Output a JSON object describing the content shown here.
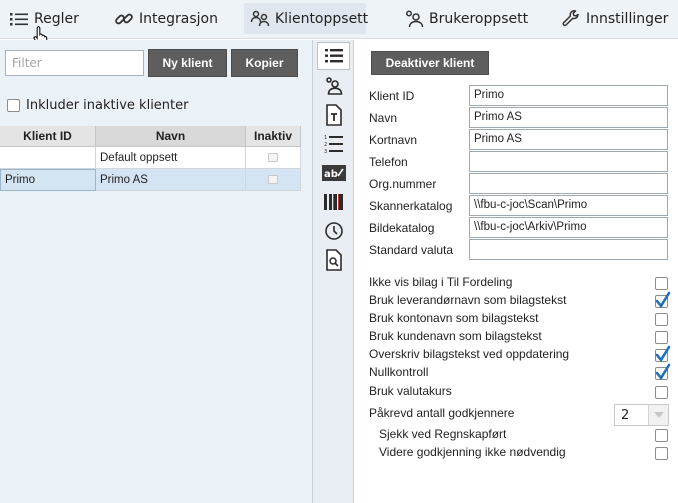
{
  "nav": {
    "items": [
      {
        "label": "Regler",
        "icon": "list-icon"
      },
      {
        "label": "Integrasjon",
        "icon": "link-icon"
      },
      {
        "label": "Klientoppsett",
        "icon": "clients-icon",
        "active": true
      },
      {
        "label": "Brukeroppsett",
        "icon": "users-icon"
      },
      {
        "label": "Innstillinger",
        "icon": "wrench-icon"
      }
    ]
  },
  "left": {
    "filter_placeholder": "Filter",
    "new_client_label": "Ny klient",
    "copy_label": "Kopier",
    "include_inactive_label": "Inkluder inaktive klienter",
    "grid": {
      "columns": [
        "Klient ID",
        "Navn",
        "Inaktiv"
      ],
      "rows": [
        {
          "id": "",
          "name": "Default oppsett",
          "inactive": false
        },
        {
          "id": "Primo",
          "name": "Primo AS",
          "inactive": false,
          "selected": true
        }
      ]
    }
  },
  "strip": {
    "icons": [
      "list-detail-icon",
      "client-user-icon",
      "document-text-icon",
      "numbered-list-icon",
      "spellcheck-icon",
      "barcode-icon",
      "clock-icon",
      "document-search-icon"
    ]
  },
  "right": {
    "deactivate_label": "Deaktiver klient",
    "fields": [
      {
        "label": "Klient ID",
        "value": "Primo"
      },
      {
        "label": "Navn",
        "value": "Primo AS"
      },
      {
        "label": "Kortnavn",
        "value": "Primo AS"
      },
      {
        "label": "Telefon",
        "value": ""
      },
      {
        "label": "Org.nummer",
        "value": ""
      },
      {
        "label": "Skannerkatalog",
        "value": "\\\\fbu-c-joc\\Scan\\Primo"
      },
      {
        "label": "Bildekatalog",
        "value": "\\\\fbu-c-joc\\Arkiv\\Primo"
      },
      {
        "label": "Standard valuta",
        "value": ""
      }
    ],
    "options": [
      {
        "label": "Ikke vis bilag i Til Fordeling",
        "checked": false
      },
      {
        "label": "Bruk leverandørnavn som bilagstekst",
        "checked": true
      },
      {
        "label": "Bruk kontonavn som bilagstekst",
        "checked": false
      },
      {
        "label": "Bruk kundenavn som bilagstekst",
        "checked": false
      },
      {
        "label": "Overskriv bilagstekst ved oppdatering",
        "checked": true
      },
      {
        "label": "Nullkontroll",
        "checked": true
      },
      {
        "label": "Bruk valutakurs",
        "checked": false
      }
    ],
    "approvers_label": "Påkrevd antall godkjennere",
    "approvers_value": "2",
    "sub_options": [
      {
        "label": "Sjekk ved Regnskapført",
        "checked": false
      },
      {
        "label": "Videre godkjenning ikke nødvendig",
        "checked": false
      }
    ]
  },
  "colors": {
    "accent_check": "#1f6fc2",
    "button_dark": "#5e5e5e",
    "selected_row": "#d4e4f2",
    "panel_bg": "#eaf1f7"
  }
}
